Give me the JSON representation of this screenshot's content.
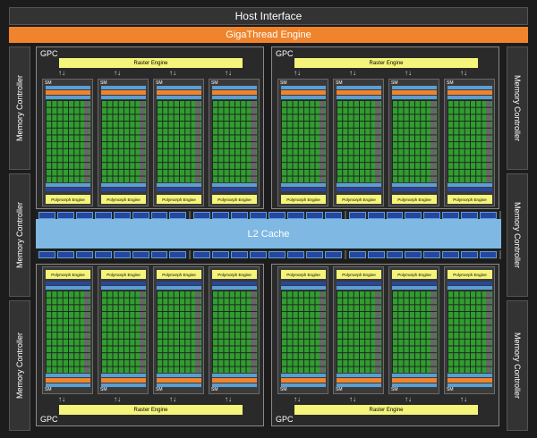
{
  "header": {
    "host_interface": "Host Interface",
    "gigathread": "GigaThread Engine"
  },
  "memory_controller_label": "Memory Controller",
  "l2_cache_label": "L2 Cache",
  "gpc_label": "GPC",
  "raster_engine_label": "Raster Engine",
  "sm_label": "SM",
  "polymorph_engine_label": "Polymorph Engine",
  "colors": {
    "orange": "#f0842c",
    "light_blue": "#7fb8e2",
    "core_green": "#2f9e2f",
    "yellow": "#f5f47a",
    "dark_blue": "#2746a0"
  }
}
